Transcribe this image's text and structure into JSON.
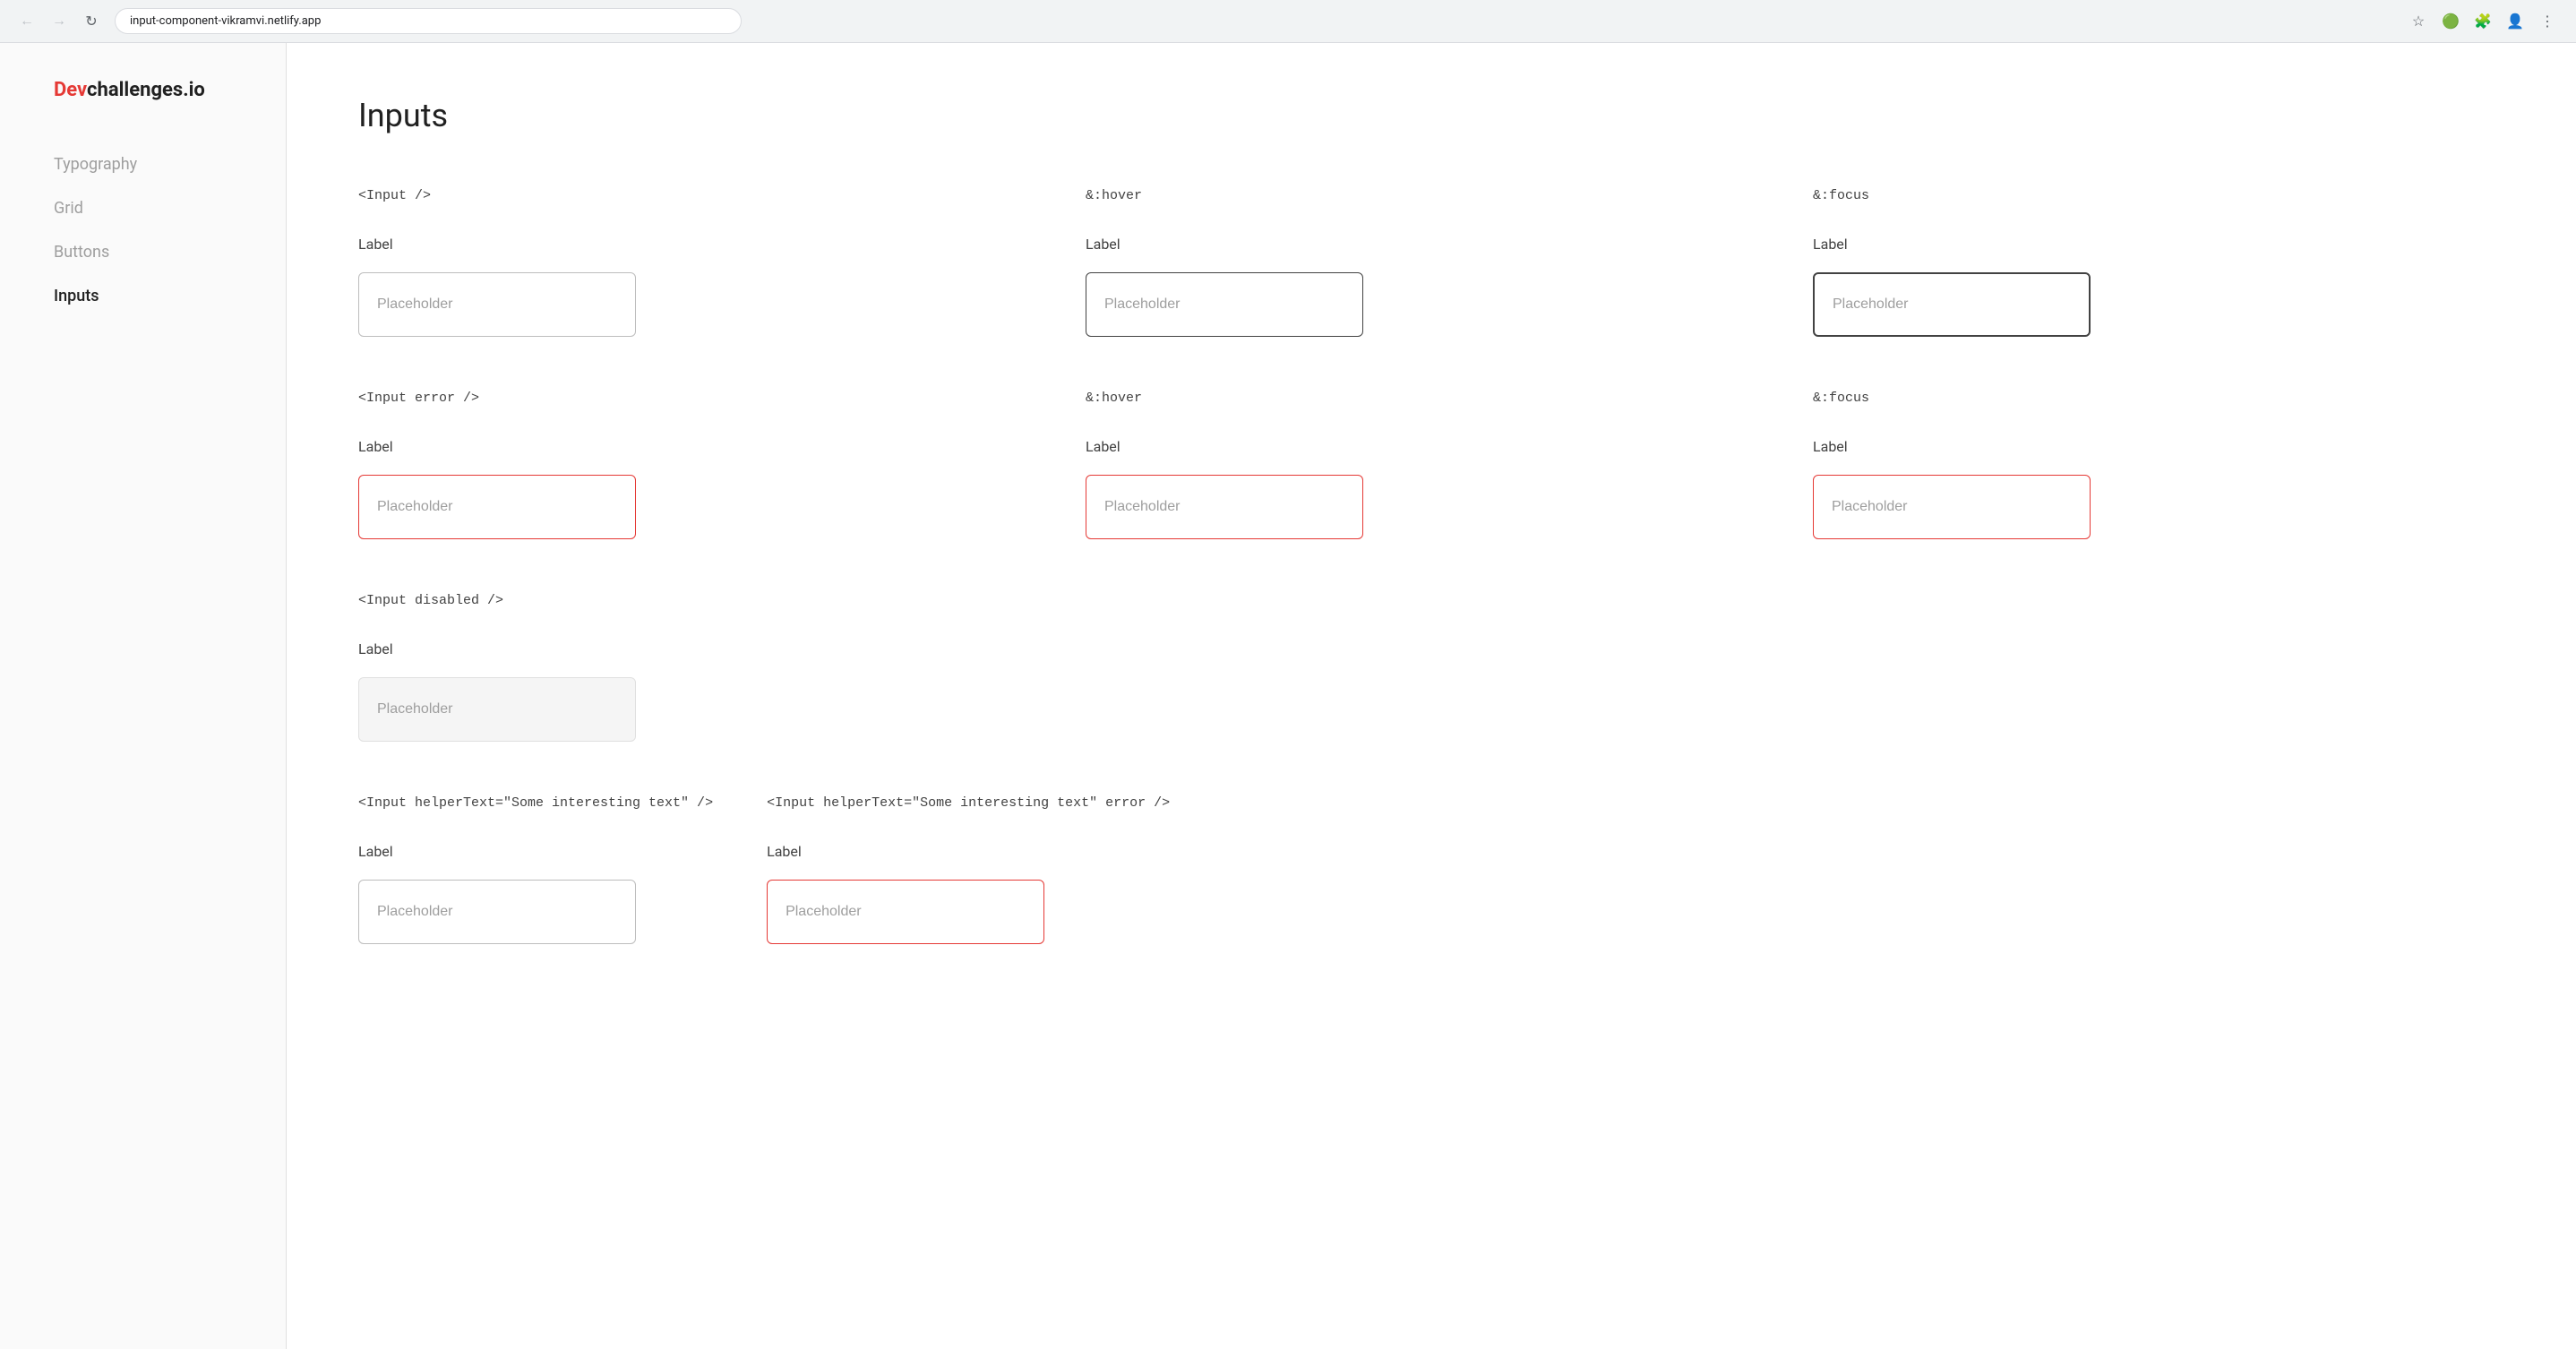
{
  "browser": {
    "url": "input-component-vikramvi.netlify.app",
    "back_btn": "←",
    "forward_btn": "→",
    "reload_btn": "↻",
    "star_icon": "☆",
    "menu_icon": "⋮"
  },
  "logo": {
    "dev_part": "Dev",
    "rest_part": "challenges.io"
  },
  "nav": {
    "items": [
      {
        "label": "Typography",
        "active": false
      },
      {
        "label": "Grid",
        "active": false
      },
      {
        "label": "Buttons",
        "active": false
      },
      {
        "label": "Inputs",
        "active": true
      }
    ]
  },
  "page": {
    "title": "Inputs"
  },
  "sections": {
    "normal": {
      "tag": "<Input />",
      "hover_tag": "&:hover",
      "focus_tag": "&:focus",
      "label": "Label",
      "placeholder": "Placeholder"
    },
    "error": {
      "tag": "<Input error />",
      "hover_tag": "&:hover",
      "focus_tag": "&:focus",
      "label": "Label",
      "placeholder": "Placeholder"
    },
    "disabled": {
      "tag": "<Input disabled />",
      "label": "Label",
      "placeholder": "Placeholder"
    },
    "helper": {
      "tag": "<Input helperText=\"Some interesting text\" />",
      "label": "Label",
      "placeholder": "Placeholder"
    },
    "helper_error": {
      "tag": "<Input helperText=\"Some interesting text\" error />",
      "label": "Label",
      "placeholder": "Placeholder"
    }
  }
}
